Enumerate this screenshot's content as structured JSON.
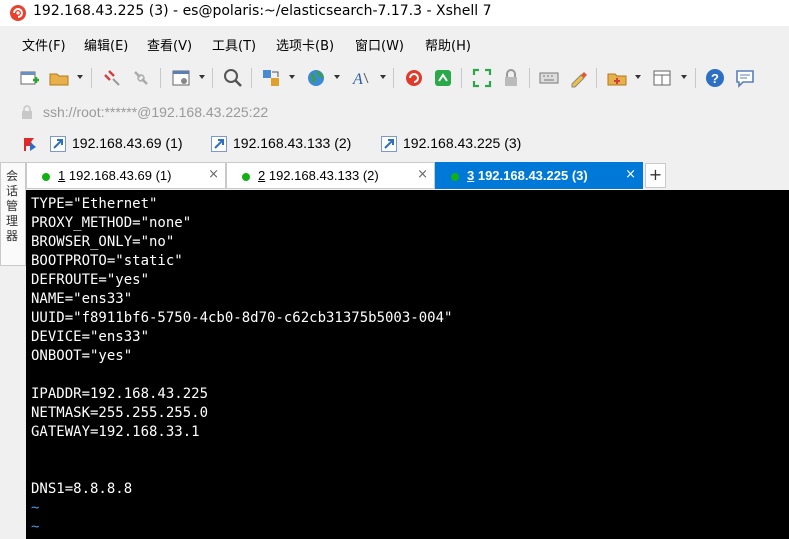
{
  "window": {
    "title": "192.168.43.225 (3) - es@polaris:~/elasticsearch-7.17.3 - Xshell 7",
    "icon": "xshell-logo"
  },
  "menu": [
    {
      "label": "文件(F)"
    },
    {
      "label": "编辑(E)"
    },
    {
      "label": "查看(V)"
    },
    {
      "label": "工具(T)"
    },
    {
      "label": "选项卡(B)"
    },
    {
      "label": "窗口(W)"
    },
    {
      "label": "帮助(H)"
    }
  ],
  "toolbar": {
    "icons": [
      "new-session-icon",
      "open-folder-icon",
      "disconnect-icon",
      "reconnect-icon",
      "properties-icon",
      "find-icon",
      "transfer-icon",
      "globe-icon",
      "font-icon",
      "xftp-icon",
      "xshell-green-icon",
      "fullscreen-icon",
      "lock-icon",
      "keyboard-icon",
      "highlight-icon",
      "compose-icon",
      "layout-icon",
      "help-icon",
      "chat-icon"
    ]
  },
  "address_bar": {
    "value": "ssh://root:******@192.168.43.225:22"
  },
  "quick_sessions": [
    {
      "label": "192.168.43.69 (1)"
    },
    {
      "label": "192.168.43.133 (2)"
    },
    {
      "label": "192.168.43.225 (3)"
    }
  ],
  "side_panel": {
    "label": "会话管理器"
  },
  "tabs": [
    {
      "number": "1",
      "label": " 192.168.43.69 (1)",
      "close": "×"
    },
    {
      "number": "2",
      "label": " 192.168.43.133 (2)",
      "close": "×"
    },
    {
      "number": "3",
      "label": " 192.168.43.225 (3)",
      "close": "×"
    }
  ],
  "new_tab": "+",
  "terminal": {
    "lines": [
      "TYPE=\"Ethernet\"",
      "PROXY_METHOD=\"none\"",
      "BROWSER_ONLY=\"no\"",
      "BOOTPROTO=\"static\"",
      "DEFROUTE=\"yes\"",
      "NAME=\"ens33\"",
      "UUID=\"f8911bf6-5750-4cb0-8d70-c62cb31375b5003-004\"",
      "DEVICE=\"ens33\"",
      "ONBOOT=\"yes\"",
      "",
      "IPADDR=192.168.43.225",
      "NETMASK=255.255.255.0",
      "GATEWAY=192.168.33.1",
      "",
      "",
      "DNS1=8.8.8.8",
      "~",
      "~"
    ]
  },
  "colors": {
    "active_tab": "#0078d7",
    "status_dot": "#12b012",
    "terminal_bg": "#000000",
    "tilde": "#3a9ee8"
  }
}
